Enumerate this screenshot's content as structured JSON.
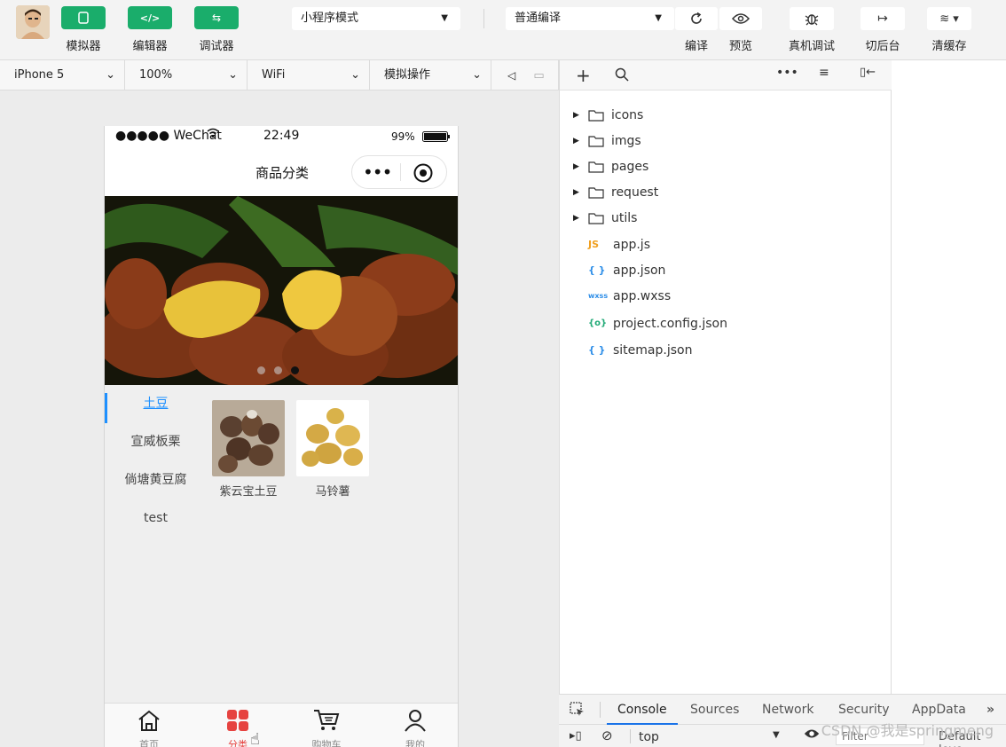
{
  "toolbar": {
    "simulator": "模拟器",
    "editor": "编辑器",
    "debugger": "调试器",
    "mode_select": "小程序模式",
    "compile_select": "普通编译",
    "compile": "编译",
    "preview": "预览",
    "remote_debug": "真机调试",
    "background": "切后台",
    "clear_cache": "清缓存"
  },
  "subbar": {
    "device": "iPhone 5",
    "zoom": "100%",
    "network": "WiFi",
    "simulate_op": "模拟操作"
  },
  "phone": {
    "carrier": "●●●●● WeChat",
    "time": "22:49",
    "battery": "99%",
    "nav_title": "商品分类",
    "menu": [
      "土豆",
      "宣威板栗",
      "倘塘黄豆腐",
      "test"
    ],
    "goods": [
      {
        "name": "紫云宝土豆"
      },
      {
        "name": "马铃薯"
      }
    ],
    "tabs": [
      "首页",
      "分类",
      "购物车",
      "我的"
    ]
  },
  "file_tree": {
    "folders": [
      "icons",
      "imgs",
      "pages",
      "request",
      "utils"
    ],
    "files": [
      {
        "icon": "JS",
        "name": "app.js",
        "color": "#f0a020"
      },
      {
        "icon": "{ }",
        "name": "app.json",
        "color": "#2f8fe8"
      },
      {
        "icon": "wxss",
        "name": "app.wxss",
        "color": "#2f8fe8"
      },
      {
        "icon": "{o}",
        "name": "project.config.json",
        "color": "#22aa77"
      },
      {
        "icon": "{ }",
        "name": "sitemap.json",
        "color": "#2f8fe8"
      }
    ]
  },
  "console": {
    "tabs": [
      "Console",
      "Sources",
      "Network",
      "Security",
      "AppData"
    ],
    "context": "top",
    "filter_placeholder": "Filter",
    "levels": "Default leve"
  },
  "watermark": "CSDN @我是springmeng"
}
